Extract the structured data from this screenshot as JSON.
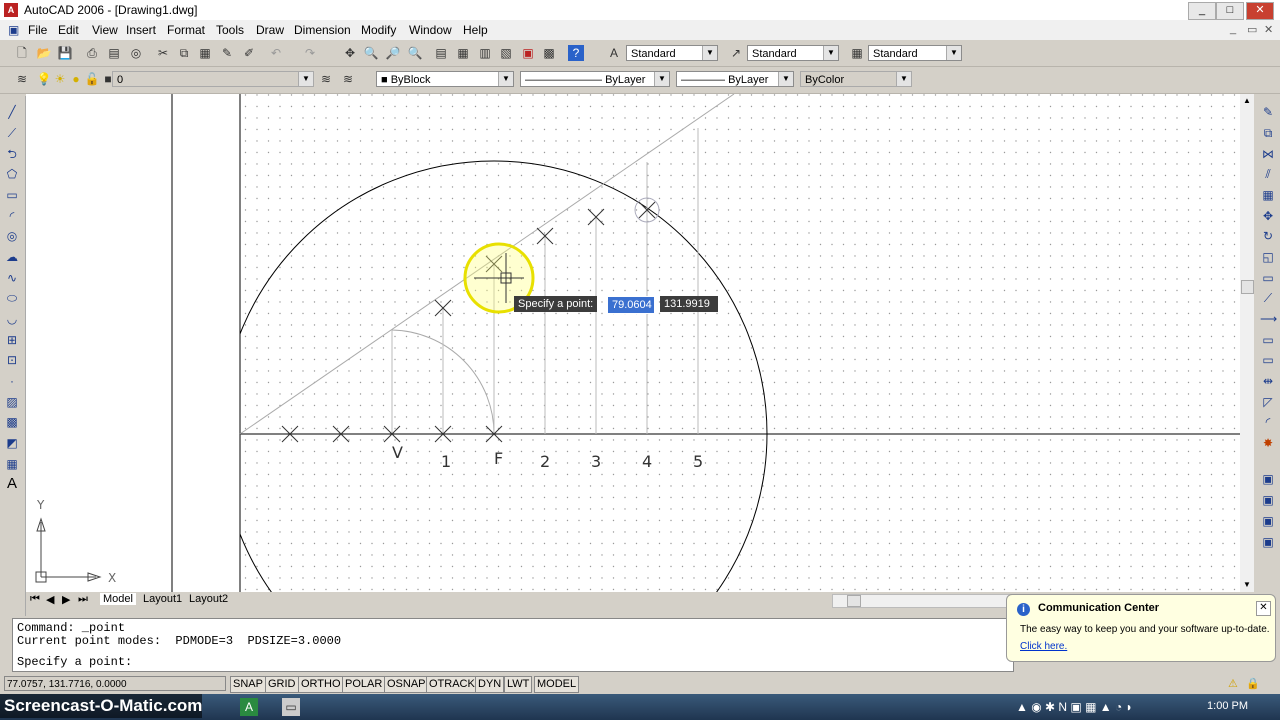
{
  "window": {
    "title": "AutoCAD 2006 - [Drawing1.dwg]"
  },
  "menu": [
    "File",
    "Edit",
    "View",
    "Insert",
    "Format",
    "Tools",
    "Draw",
    "Dimension",
    "Modify",
    "Window",
    "Help"
  ],
  "toolbar": {
    "text_style": "Standard",
    "dim_style": "Standard",
    "table_style": "Standard",
    "layer": "0",
    "color": "ByBlock",
    "linetype": "ByLayer",
    "lineweight": "ByLayer",
    "plotstyle": "ByColor"
  },
  "drawing": {
    "labels": [
      "V",
      "1",
      "F",
      "2",
      "3",
      "4",
      "5"
    ],
    "ucs": {
      "x": "X",
      "y": "Y"
    }
  },
  "dynamic_input": {
    "prompt": "Specify a point:",
    "x_value": "79.0604",
    "y_value": "131.9919"
  },
  "tabs": [
    "Model",
    "Layout1",
    "Layout2"
  ],
  "command_window": {
    "lines": [
      "Command: _point",
      "Current point modes:  PDMODE=3  PDSIZE=3.0000",
      "Specify a point:"
    ]
  },
  "status": {
    "coords": "77.0757, 131.7716, 0.0000",
    "buttons": [
      "SNAP",
      "GRID",
      "ORTHO",
      "POLAR",
      "OSNAP",
      "OTRACK",
      "DYN",
      "LWT",
      "MODEL"
    ]
  },
  "notification": {
    "title": "Communication Center",
    "text": "The easy way to keep you and your software up-to-date.",
    "link": "Click here."
  },
  "taskbar": {
    "watermark": "Screencast-O-Matic.com",
    "clock": "1:00 PM"
  }
}
